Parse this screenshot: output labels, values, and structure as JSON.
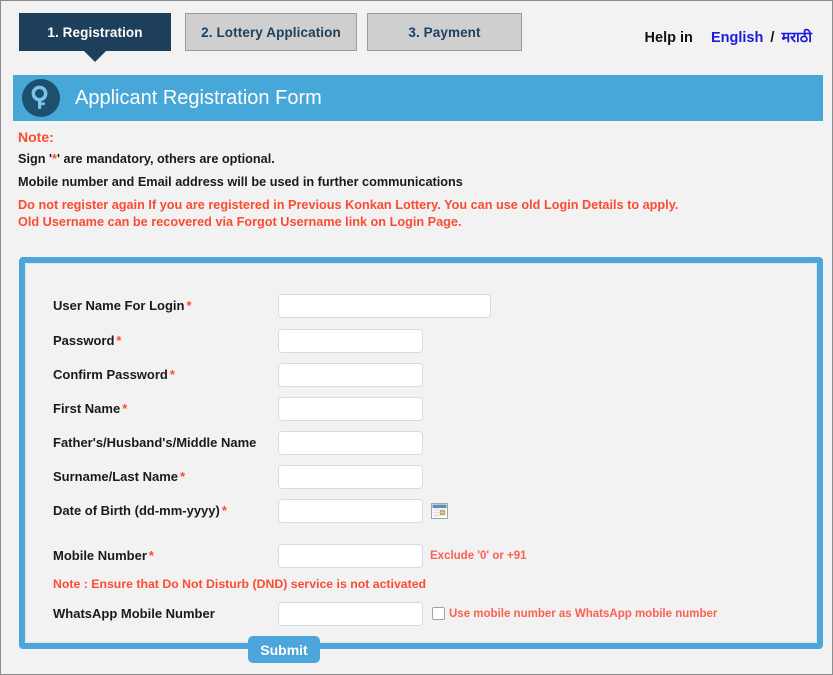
{
  "tabs": [
    {
      "label": "1. Registration",
      "active": true
    },
    {
      "label": "2. Lottery Application",
      "active": false
    },
    {
      "label": "3. Payment",
      "active": false
    }
  ],
  "help": {
    "label": "Help in",
    "english": "English",
    "separator": "/",
    "marathi": "मराठी"
  },
  "header": {
    "title": "Applicant Registration Form",
    "icon": "key-icon"
  },
  "notes": {
    "heading": "Note:",
    "line1_before": "Sign '",
    "line1_asterisk": "*",
    "line1_after": "' are mandatory, others are optional.",
    "line2": "Mobile number and Email address will be used in further communications",
    "red1": "Do not register again If you are registered in Previous Konkan Lottery. You can use old Login Details to apply.",
    "red2": "Old Username can be recovered via Forgot Username link on Login Page."
  },
  "form": {
    "fields": [
      {
        "label": "User Name For Login",
        "required": true,
        "value": "",
        "placeholder": ""
      },
      {
        "label": "Password",
        "required": true,
        "value": "",
        "placeholder": ""
      },
      {
        "label": "Confirm Password",
        "required": true,
        "value": "",
        "placeholder": ""
      },
      {
        "label": "First Name",
        "required": true,
        "value": "",
        "placeholder": ""
      },
      {
        "label": "Father's/Husband's/Middle Name",
        "required": false,
        "value": "",
        "placeholder": ""
      },
      {
        "label": "Surname/Last Name",
        "required": true,
        "value": "",
        "placeholder": ""
      },
      {
        "label": "Date of Birth (dd-mm-yyyy)",
        "required": true,
        "value": "",
        "placeholder": ""
      },
      {
        "label": "Mobile Number",
        "required": true,
        "value": "",
        "placeholder": ""
      },
      {
        "label": "WhatsApp Mobile Number",
        "required": false,
        "value": "",
        "placeholder": ""
      }
    ],
    "mobile_hint": "Exclude '0' or +91",
    "dnd_note": "Note : Ensure that Do Not Disturb (DND) service is not activated",
    "whatsapp_checkbox_label": "Use mobile number as WhatsApp mobile number",
    "whatsapp_checkbox_checked": false,
    "calendar_icon": "calendar-icon",
    "submit_label": "Submit"
  },
  "colors": {
    "accent_blue": "#46a7d8",
    "panel_border_blue": "#4ca6d9",
    "active_tab_navy": "#1d3f5c",
    "inactive_tab_gray": "#cfcfcf",
    "alert_red": "#fb4c33",
    "hint_red": "#fb6151",
    "link_blue": "#1b1bdd",
    "page_bg": "#f2f2f2"
  }
}
